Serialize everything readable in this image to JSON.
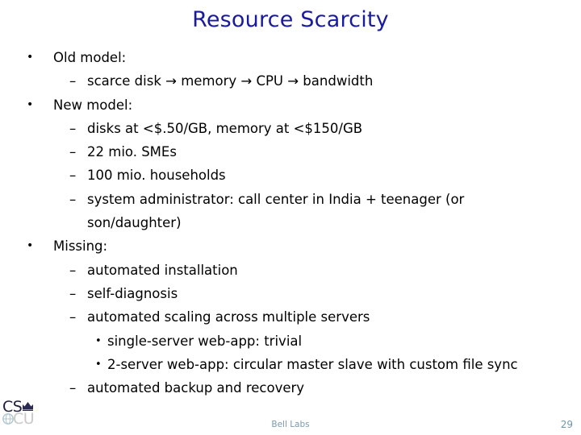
{
  "slide": {
    "title": "Resource Scarcity",
    "title_color": "#1a1a9e",
    "background_color": "#ffffff",
    "text_color": "#000000"
  },
  "markers": {
    "level1": "•",
    "level2": "–",
    "level3": "•"
  },
  "content": {
    "lines": [
      {
        "level": 1,
        "text": "Old model:"
      },
      {
        "level": 2,
        "text": "scarce disk → memory → CPU → bandwidth"
      },
      {
        "level": 1,
        "text": "New model:"
      },
      {
        "level": 2,
        "text": "disks at <$.50/GB, memory at <$150/GB"
      },
      {
        "level": 2,
        "text": "22 mio. SMEs"
      },
      {
        "level": 2,
        "text": "100 mio. households"
      },
      {
        "level": 2,
        "text": "system administrator: call center in India + teenager (or"
      },
      {
        "level": 0,
        "text": "son/daughter)"
      },
      {
        "level": 1,
        "text": "Missing:"
      },
      {
        "level": 2,
        "text": "automated installation"
      },
      {
        "level": 2,
        "text": "self-diagnosis"
      },
      {
        "level": 2,
        "text": "automated scaling across multiple servers"
      },
      {
        "level": 3,
        "text": "single-server web-app: trivial"
      },
      {
        "level": 3,
        "text": "2-server web-app: circular master slave with custom file sync"
      },
      {
        "level": 2,
        "text": "automated backup and recovery"
      }
    ]
  },
  "footer": {
    "logo_primary": "CS",
    "logo_secondary": "CU",
    "logo_crown_icon": "crown-icon",
    "logo_globe_icon": "globe-icon",
    "center_text": "Bell Labs",
    "center_color": "#7a9ab0",
    "page_number": "29",
    "page_color": "#6d96ae"
  }
}
